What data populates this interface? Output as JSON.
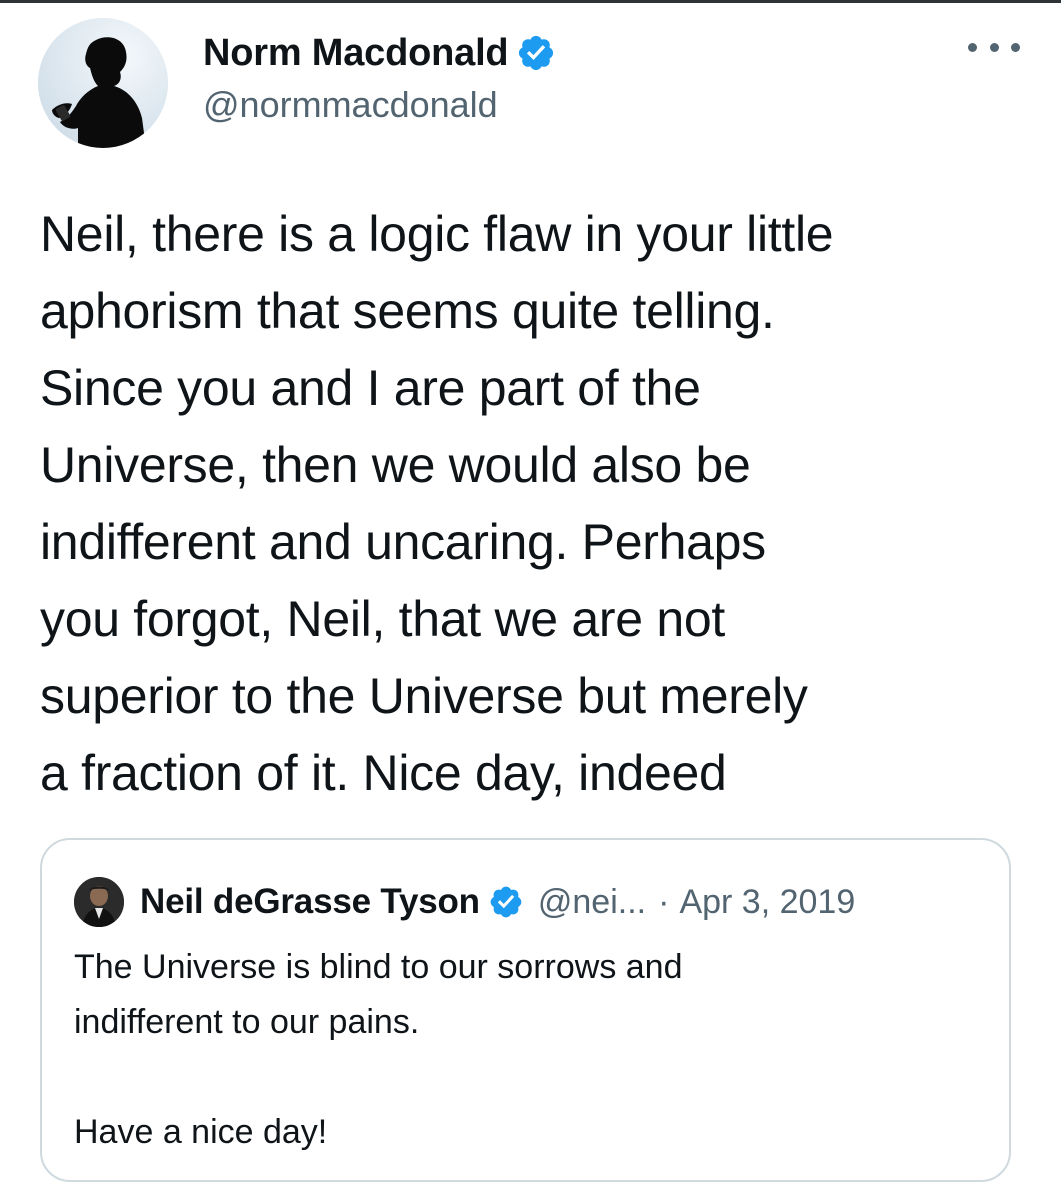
{
  "tweet": {
    "author": {
      "name": "Norm Macdonald",
      "handle": "@normmacdonald",
      "verified": true
    },
    "text": "Neil, there is a logic flaw in your little\naphorism that seems quite telling.\nSince you and I are part of the\nUniverse, then we would also be\nindifferent and uncaring. Perhaps\nyou forgot, Neil, that we are not\nsuperior to the Universe but merely\na fraction of it. Nice day, indeed",
    "more_icon": "more-horizontal-icon"
  },
  "quoted_tweet": {
    "author": {
      "name": "Neil deGrasse Tyson",
      "handle": "@nei...",
      "verified": true
    },
    "separator": "·",
    "date": "Apr 3, 2019",
    "text": "The Universe is blind to our sorrows and\nindifferent to our pains.\n\nHave  a nice day!"
  },
  "colors": {
    "text": "#0f1419",
    "secondary_text": "#536471",
    "verified_badge": "#1d9bf0",
    "card_border": "#cfd9de"
  }
}
